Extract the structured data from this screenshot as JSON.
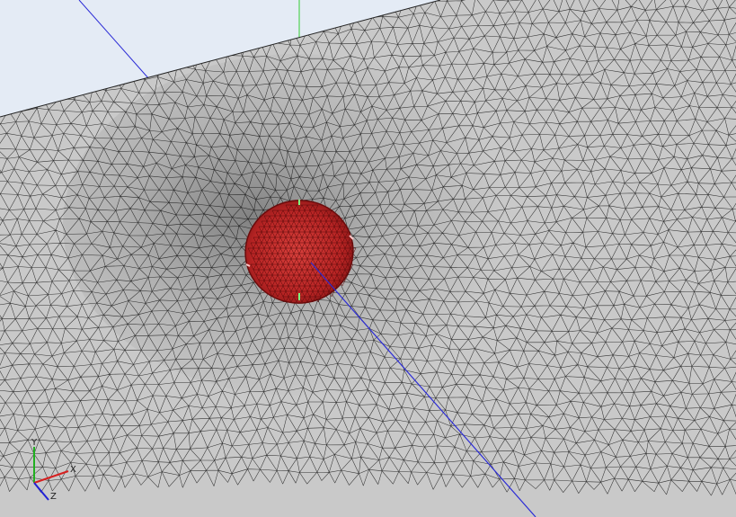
{
  "viewport": {
    "background_color": "#e4ebf5",
    "mesh_fill_color": "#c9c9c9",
    "mesh_edge_color": "#333333",
    "highlight_fill_color": "#c42b2b",
    "highlight_edge_color": "#5a0a0a",
    "axis_line_color": "#2b2bd6",
    "vertical_axis_color": "#33cc33"
  },
  "orientation_triad": {
    "x_label": "X",
    "y_label": "Y",
    "z_label": "Z",
    "x_color": "#d62020",
    "y_color": "#20b020",
    "z_color": "#2020d6"
  }
}
